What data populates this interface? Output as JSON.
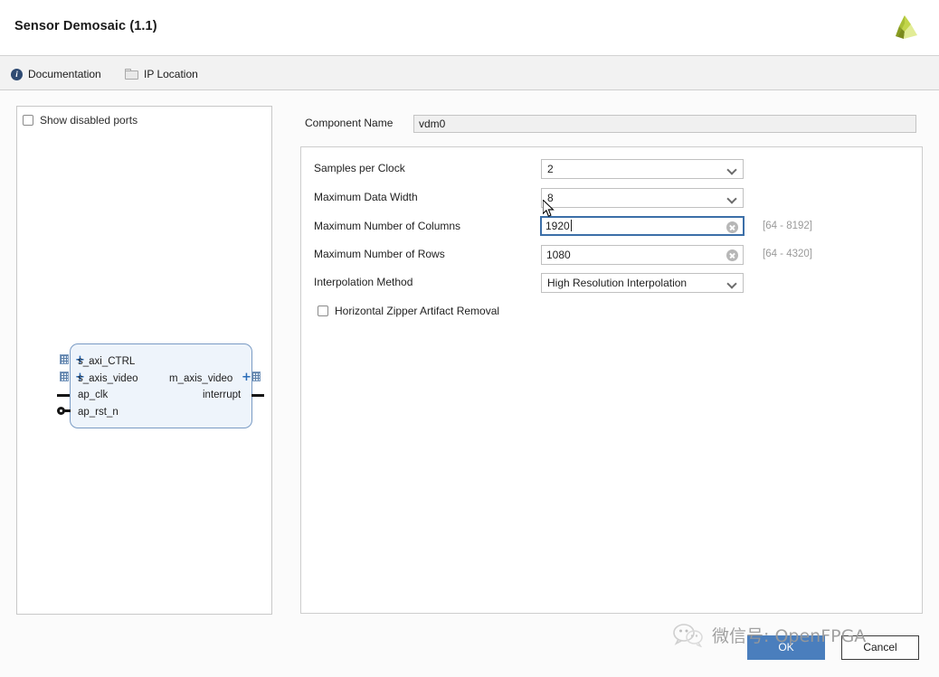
{
  "window": {
    "title": "Sensor Demosaic (1.1)",
    "logo_icon": "xilinx-logo-icon",
    "logo_colors": {
      "dark_olive": "#6f7a18",
      "mid_green": "#9dbb2a",
      "light_lime": "#d7e57a"
    }
  },
  "toolbar": {
    "items": [
      {
        "label": "Documentation",
        "icon": "info-icon"
      },
      {
        "label": "IP Location",
        "icon": "folder-icon"
      }
    ]
  },
  "ports_panel": {
    "show_disabled_ports": {
      "label": "Show disabled ports",
      "checked": false
    },
    "ip_symbol": {
      "left_ports": [
        {
          "name": "s_axi_CTRL",
          "kind": "bus",
          "expandable": true
        },
        {
          "name": "s_axis_video",
          "kind": "bus",
          "expandable": true
        },
        {
          "name": "ap_clk",
          "kind": "clock",
          "expandable": false
        },
        {
          "name": "ap_rst_n",
          "kind": "reset-active-low",
          "expandable": false
        }
      ],
      "right_ports": [
        {
          "name": "m_axis_video",
          "kind": "bus",
          "expandable": true
        },
        {
          "name": "interrupt",
          "kind": "signal",
          "expandable": false
        }
      ],
      "fill_color": "#eef4fb",
      "border_color": "#7a9bc4"
    }
  },
  "config": {
    "component_name": {
      "label": "Component Name",
      "value": "vdm0"
    },
    "params": [
      {
        "label": "Samples per Clock",
        "control": "combobox",
        "value": "2",
        "hint": ""
      },
      {
        "label": "Maximum Data Width",
        "control": "combobox",
        "value": "8",
        "hint": ""
      },
      {
        "label": "Maximum Number of Columns",
        "control": "lineedit",
        "value": "1920",
        "hint": "[64 - 8192]",
        "focused": true
      },
      {
        "label": "Maximum Number of Rows",
        "control": "lineedit",
        "value": "1080",
        "hint": "[64 - 4320]",
        "focused": false
      },
      {
        "label": "Interpolation Method",
        "control": "combobox",
        "value": "High Resolution Interpolation",
        "hint": ""
      }
    ],
    "zipper_removal": {
      "label": "Horizontal Zipper Artifact Removal",
      "checked": false
    }
  },
  "buttons": {
    "ok": "OK",
    "cancel": "Cancel",
    "ok_color": "#4a7ebd"
  },
  "watermark": {
    "text": "微信号: OpenFPGA",
    "icon": "wechat-icon"
  }
}
